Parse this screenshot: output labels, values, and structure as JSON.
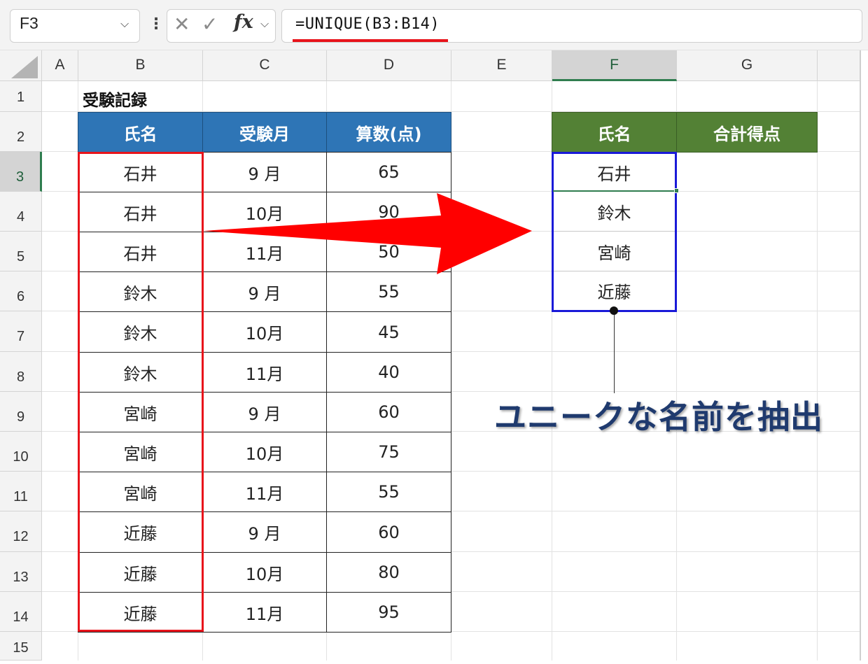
{
  "formula_bar": {
    "name_box": "F3",
    "formula": "=UNIQUE(B3:B14)"
  },
  "columns": [
    "A",
    "B",
    "C",
    "D",
    "E",
    "F",
    "G"
  ],
  "selected_column": "F",
  "rows": [
    "1",
    "2",
    "3",
    "4",
    "5",
    "6",
    "7",
    "8",
    "9",
    "10",
    "11",
    "12",
    "13",
    "14",
    "15"
  ],
  "selected_row": "3",
  "sheet": {
    "title": "受験記録",
    "source_headers": [
      "氏名",
      "受験月",
      "算数(点)"
    ],
    "source_rows": [
      [
        "石井",
        "9 月",
        "65"
      ],
      [
        "石井",
        "10月",
        "90"
      ],
      [
        "石井",
        "11月",
        "50"
      ],
      [
        "鈴木",
        "9 月",
        "55"
      ],
      [
        "鈴木",
        "10月",
        "45"
      ],
      [
        "鈴木",
        "11月",
        "40"
      ],
      [
        "宮崎",
        "9 月",
        "60"
      ],
      [
        "宮崎",
        "10月",
        "75"
      ],
      [
        "宮崎",
        "11月",
        "55"
      ],
      [
        "近藤",
        "9 月",
        "60"
      ],
      [
        "近藤",
        "10月",
        "80"
      ],
      [
        "近藤",
        "11月",
        "95"
      ]
    ],
    "result_headers": [
      "氏名",
      "合計得点"
    ],
    "result_names": [
      "石井",
      "鈴木",
      "宮崎",
      "近藤"
    ]
  },
  "annotation": {
    "callout": "ユニークな名前を抽出"
  },
  "colors": {
    "header_blue": "#2e75b6",
    "header_green": "#538135",
    "highlight_red": "#e8141b",
    "highlight_blue": "#1a1ad8",
    "callout_text": "#1f3a6e"
  },
  "icons": [
    "cancel-icon",
    "enter-icon",
    "fx-icon",
    "chevron-down-icon",
    "select-all-icon",
    "arrow-right-icon"
  ]
}
